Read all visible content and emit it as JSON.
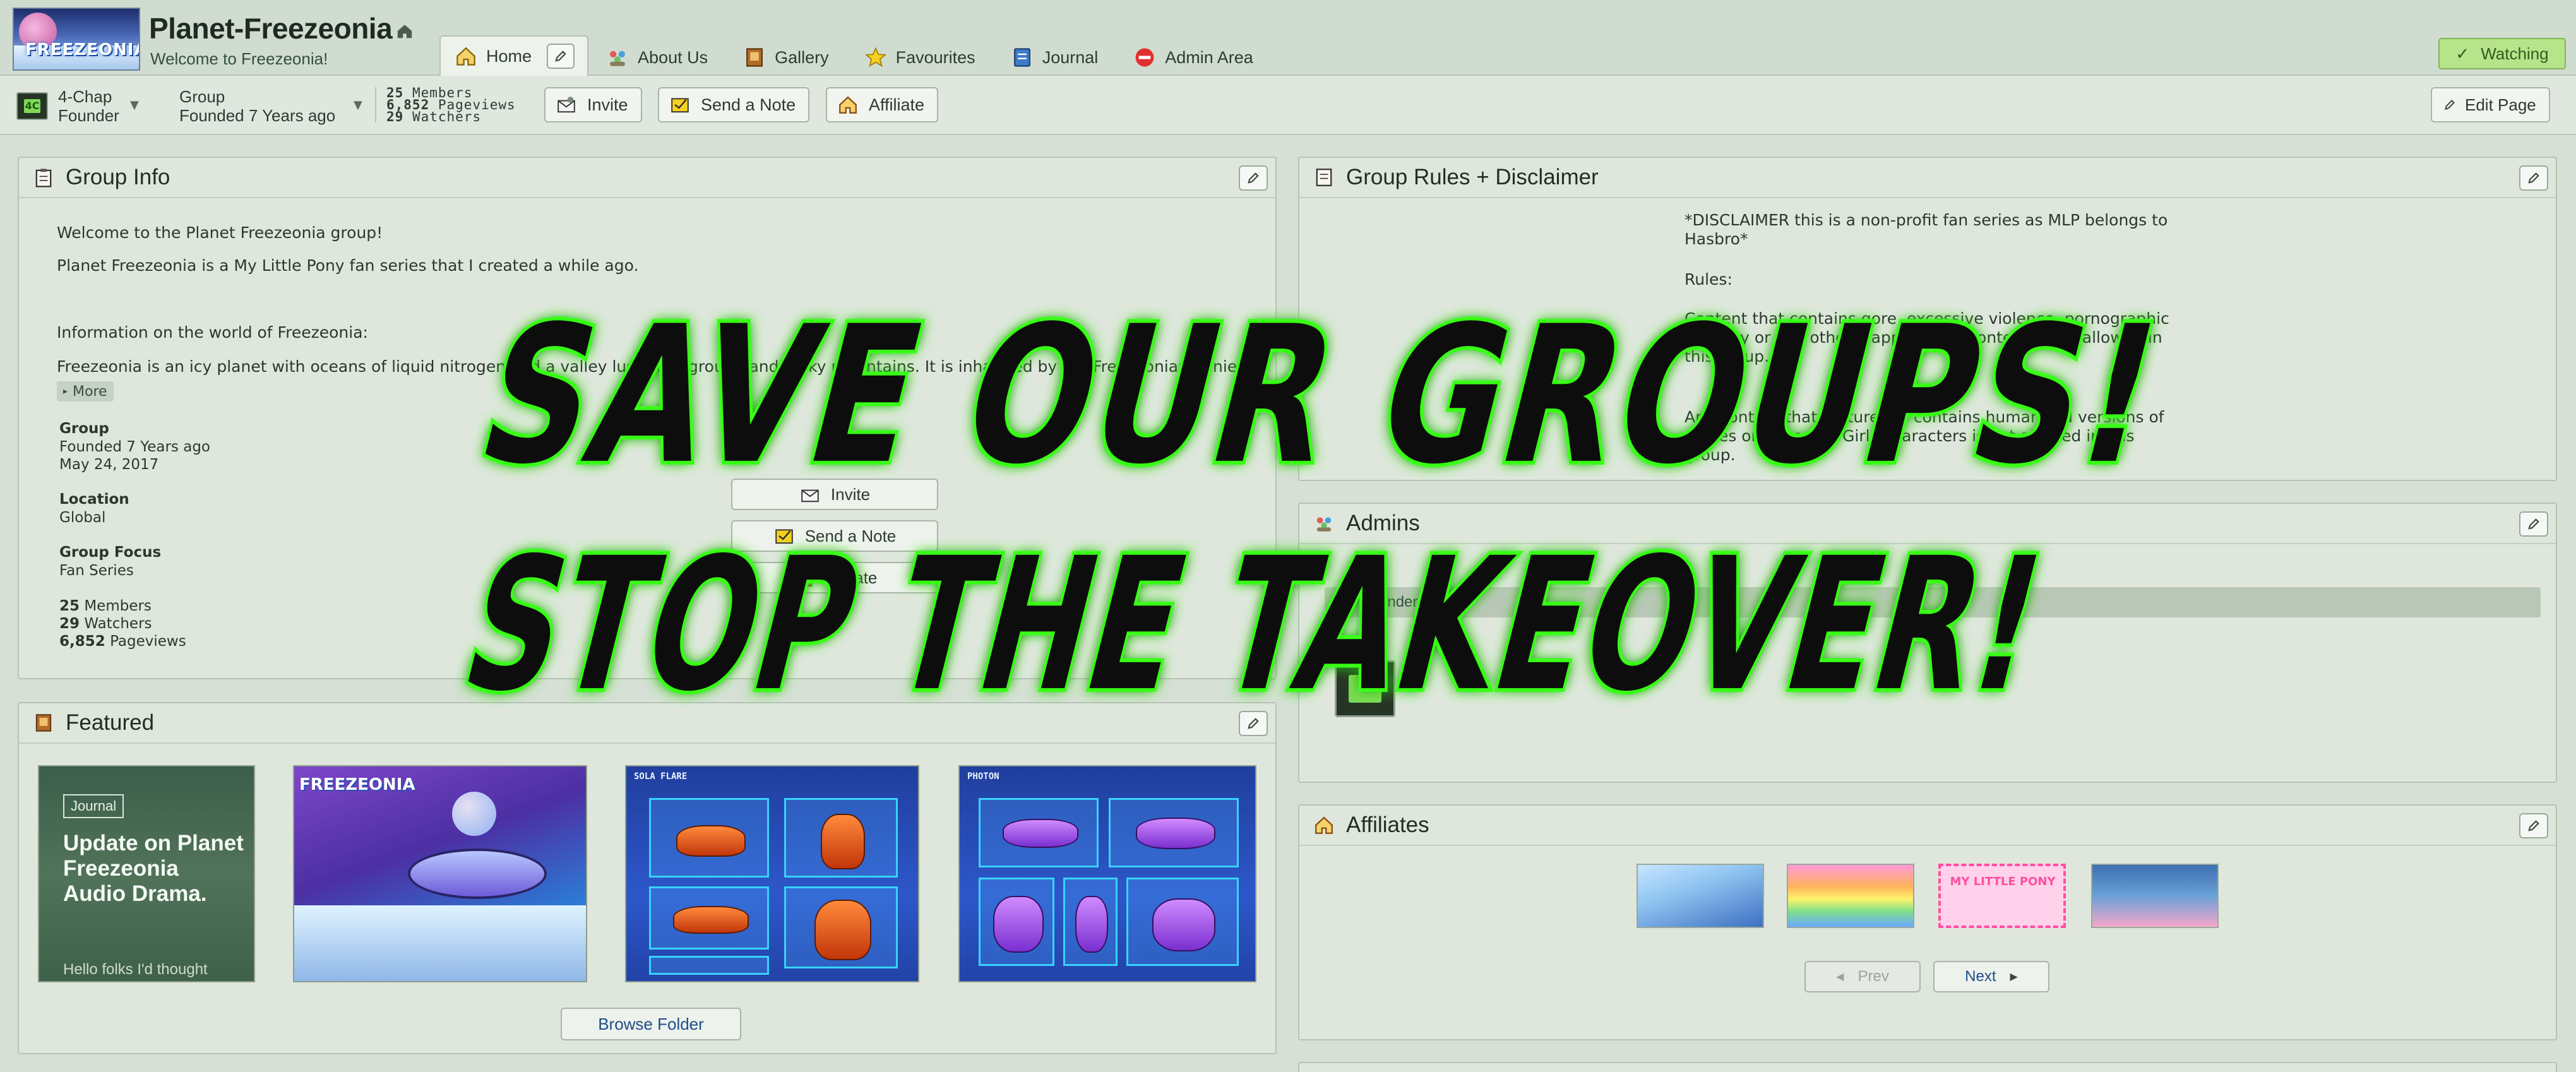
{
  "header": {
    "group_name": "Planet-Freezeonia",
    "tagline": "Welcome to Freezeonia!",
    "logo_text": "FREEZEONIA",
    "tabs": [
      {
        "label": "Home",
        "icon": "home-icon"
      },
      {
        "label": "About Us",
        "icon": "people-icon"
      },
      {
        "label": "Gallery",
        "icon": "gallery-icon"
      },
      {
        "label": "Favourites",
        "icon": "star-icon"
      },
      {
        "label": "Journal",
        "icon": "journal-icon"
      },
      {
        "label": "Admin Area",
        "icon": "no-entry-icon"
      }
    ],
    "watch_label": "Watching"
  },
  "subbar": {
    "owner_name": "4-Chap",
    "owner_role": "Founder",
    "group_type": "Group",
    "founded": "Founded 7 Years ago",
    "stats": {
      "members": "25",
      "members_label": "Members",
      "pageviews": "6,852",
      "pageviews_label": "Pageviews",
      "watchers": "29",
      "watchers_label": "Watchers"
    },
    "buttons": {
      "invite": "Invite",
      "send_note": "Send a Note",
      "affiliate": "Affiliate"
    },
    "edit_page": "Edit Page"
  },
  "group_info": {
    "title": "Group Info",
    "lines": [
      "Welcome to the Planet Freezeonia group!",
      "Planet Freezeonia is a My Little Pony fan series that I created a while ago.",
      "Information on the world of Freezeonia:",
      "Freezeonia is an icy planet with oceans of liquid nitrogen and a valley lush with ground and rocky mountains. It is inhabited by the Freezeonian ponies."
    ],
    "more": "More",
    "labels": {
      "group": "Group",
      "location": "Location",
      "focus": "Group Focus"
    },
    "values": {
      "founded": "Founded 7 Years ago",
      "date": "May 24, 2017",
      "location": "Global",
      "focus": "Fan Series",
      "members": "25",
      "members_label": "Members",
      "watchers": "29",
      "watchers_label": "Watchers",
      "pageviews": "6,852",
      "pageviews_label": "Pageviews"
    },
    "buttons": {
      "invite": "Invite",
      "send_note": "Send a Note",
      "affiliate": "Affiliate"
    }
  },
  "featured": {
    "title": "Featured",
    "journal_badge": "Journal",
    "journal_title": "Update on Planet Freezeonia Audio Drama.",
    "journal_snippet": "Hello folks I'd thought",
    "thumb2_logo": "FREEZEONIA",
    "thumb3_label": "SOLA FLARE",
    "thumb4_label": "PHOTON",
    "browse": "Browse Folder"
  },
  "rules": {
    "title": "Group Rules + Disclaimer",
    "lines": [
      "*DISCLAIMER this is a non-profit fan series as MLP belongs to",
      "Hasbro*",
      "Rules:",
      "Content that contains gore, excessive violence, pornographic",
      "imagery or any other inappropriate content is not allowed in",
      "this group.",
      "Any content that features or contains humanised versions of",
      "ponies or Equestria Girls characters is not allowed in this",
      "group."
    ]
  },
  "admins": {
    "title": "Admins",
    "strip": "Founder"
  },
  "affiliates": {
    "title": "Affiliates",
    "prev": "Prev",
    "next": "Next",
    "thumb3_text": "MY LITTLE PONY"
  },
  "overlay": {
    "line1": "SAVE OUR GROUPS!",
    "line2": "STOP THE TAKEOVER!",
    "stroke_color": "#39ff14",
    "fill_color": "#0b0b0b"
  },
  "colors": {
    "accent_green": "#b7e38a",
    "link_blue": "#1e4f8a",
    "panel_bg": "#dfe7dd"
  }
}
